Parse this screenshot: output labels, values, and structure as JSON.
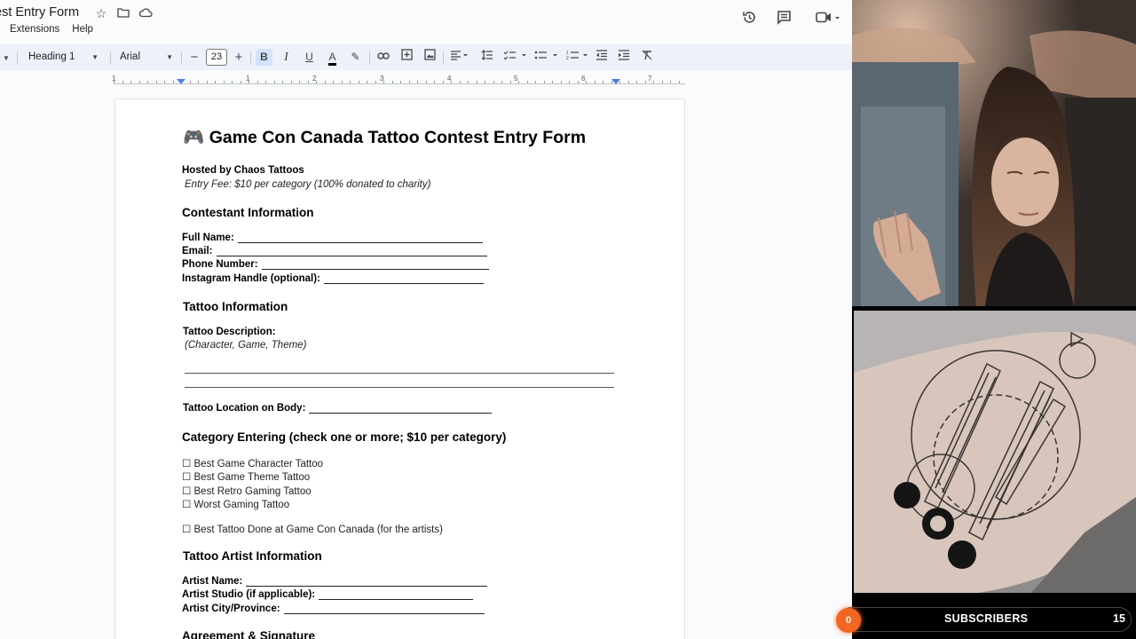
{
  "docs": {
    "title": "est Entry Form",
    "menu": [
      "Extensions",
      "Help"
    ],
    "toolbar": {
      "style_select": "Heading 1",
      "font_select": "Arial",
      "font_size": "23",
      "bold_label": "B",
      "italic_label": "I",
      "underline_label": "U",
      "text_color_label": "A"
    },
    "ruler_numbers": [
      "1",
      "1",
      "2",
      "3",
      "4",
      "5",
      "6",
      "7"
    ]
  },
  "document": {
    "title_icon": "🎮",
    "title": "Game Con Canada Tattoo Contest Entry Form",
    "hosted_by": "Hosted by Chaos Tattoos",
    "entry_fee": "Entry Fee: $10 per category (100% donated to charity)",
    "contestant_heading": "Contestant Information",
    "full_name_label": "Full Name:",
    "email_label": "Email:",
    "phone_label": "Phone Number:",
    "instagram_label": "Instagram Handle (optional):",
    "tattoo_info_heading": "Tattoo Information",
    "tattoo_description_label": "Tattoo Description:",
    "tattoo_description_hint": "(Character, Game, Theme)",
    "tattoo_location_label": "Tattoo Location on Body:",
    "category_heading": "Category Entering (check one or more; $10 per category)",
    "categories": [
      "☐ Best Game Character Tattoo",
      "☐ Best Game Theme Tattoo",
      "☐ Best Retro Gaming Tattoo",
      "☐ Worst Gaming Tattoo"
    ],
    "artist_category": "☐ Best Tattoo Done at Game Con Canada (for the artists)",
    "artist_heading": "Tattoo Artist Information",
    "artist_name_label": "Artist Name:",
    "artist_studio_label": "Artist Studio (if applicable):",
    "artist_city_label": "Artist City/Province:",
    "agreement_heading": "Agreement & Signature"
  },
  "stream": {
    "subscriber_count": "0",
    "subscriber_label": "SUBSCRIBERS",
    "subscriber_goal": "15"
  },
  "colors": {
    "accent": "#f26522",
    "toolbar_bg": "#edf2fa",
    "bold_active": "#d3e3fd"
  }
}
